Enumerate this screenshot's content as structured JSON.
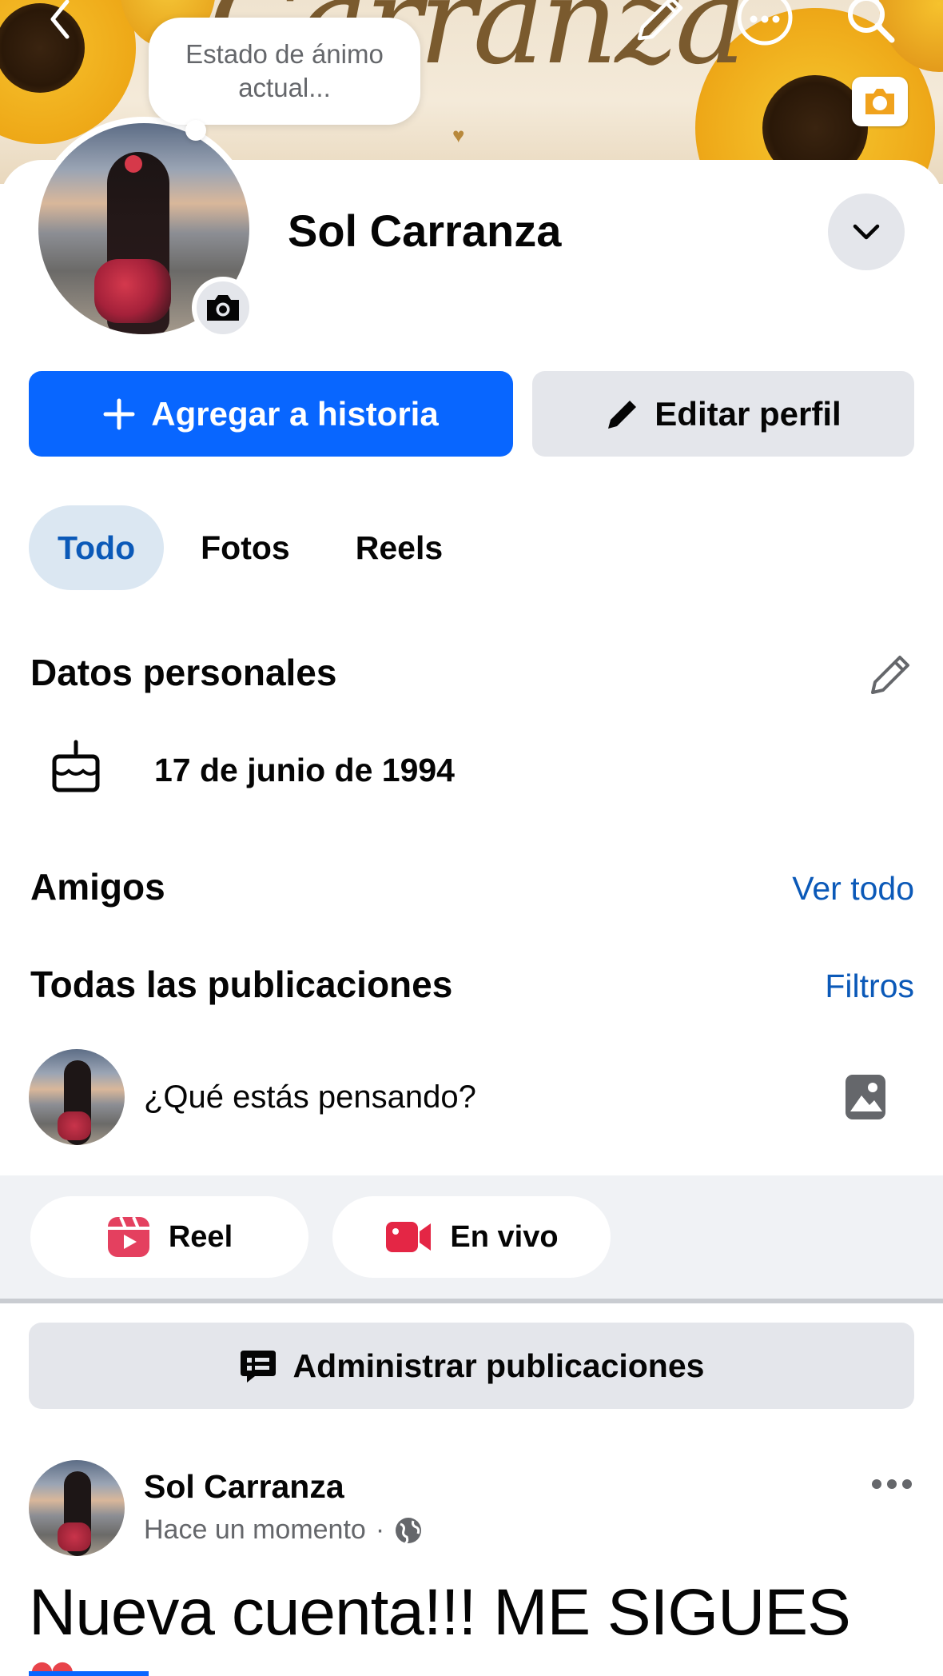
{
  "cover": {
    "title_text": "Carranza",
    "icons": [
      "chevron-left-icon",
      "pencil-icon",
      "more-icon",
      "search-icon",
      "camera-icon"
    ]
  },
  "mood": {
    "placeholder": "Estado de ánimo actual..."
  },
  "profile": {
    "name": "Sol Carranza"
  },
  "actions": {
    "add_story": "Agregar a historia",
    "edit_profile": "Editar perfil"
  },
  "tabs": [
    {
      "label": "Todo",
      "active": true
    },
    {
      "label": "Fotos",
      "active": false
    },
    {
      "label": "Reels",
      "active": false
    }
  ],
  "personal": {
    "title": "Datos personales",
    "birthday": "17 de junio de 1994"
  },
  "friends": {
    "title": "Amigos",
    "see_all": "Ver todo"
  },
  "posts_section": {
    "title": "Todas las publicaciones",
    "filters": "Filtros"
  },
  "composer": {
    "placeholder": "¿Qué estás pensando?",
    "reel": "Reel",
    "live": "En vivo"
  },
  "manage": {
    "label": "Administrar publicaciones"
  },
  "post": {
    "author": "Sol Carranza",
    "time": "Hace un momento",
    "separator": "·",
    "body": "Nueva cuenta!!! ME SIGUES",
    "emoji": "❤"
  },
  "colors": {
    "primary": "#0866ff",
    "link": "#0b59b8",
    "tab_active_bg": "#dbe7f2",
    "secondary_bg": "#e4e6eb",
    "reel_icon": "#e4405f",
    "live_icon": "#e42645"
  }
}
